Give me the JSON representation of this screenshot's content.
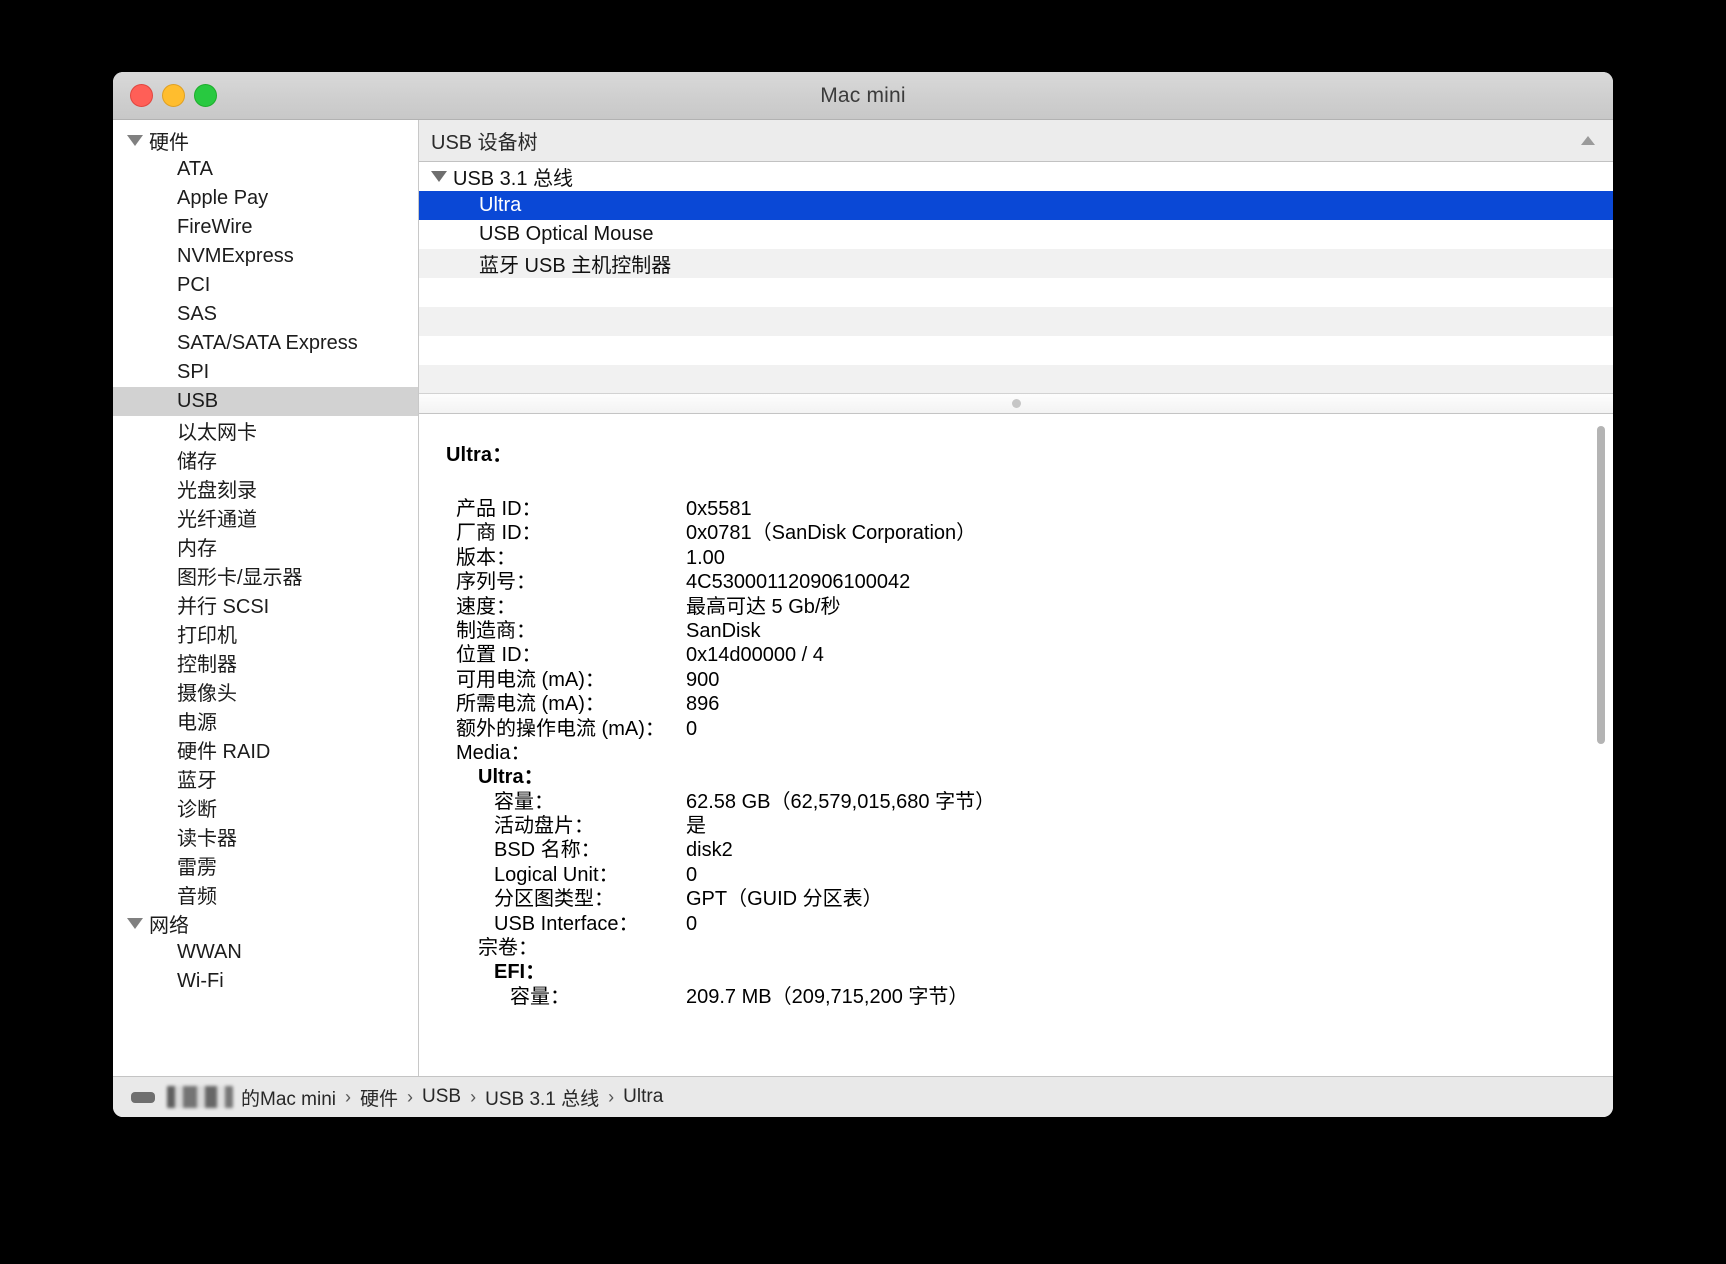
{
  "window": {
    "title": "Mac mini",
    "traffic_lights": [
      "close",
      "minimize",
      "maximize"
    ]
  },
  "sidebar": {
    "groups": [
      {
        "label": "硬件",
        "expanded": true,
        "items": [
          {
            "label": "ATA",
            "selected": false
          },
          {
            "label": "Apple Pay",
            "selected": false
          },
          {
            "label": "FireWire",
            "selected": false
          },
          {
            "label": "NVMExpress",
            "selected": false
          },
          {
            "label": "PCI",
            "selected": false
          },
          {
            "label": "SAS",
            "selected": false
          },
          {
            "label": "SATA/SATA Express",
            "selected": false
          },
          {
            "label": "SPI",
            "selected": false
          },
          {
            "label": "USB",
            "selected": true
          },
          {
            "label": "以太网卡",
            "selected": false
          },
          {
            "label": "储存",
            "selected": false
          },
          {
            "label": "光盘刻录",
            "selected": false
          },
          {
            "label": "光纤通道",
            "selected": false
          },
          {
            "label": "内存",
            "selected": false
          },
          {
            "label": "图形卡/显示器",
            "selected": false
          },
          {
            "label": "并行 SCSI",
            "selected": false
          },
          {
            "label": "打印机",
            "selected": false
          },
          {
            "label": "控制器",
            "selected": false
          },
          {
            "label": "摄像头",
            "selected": false
          },
          {
            "label": "电源",
            "selected": false
          },
          {
            "label": "硬件 RAID",
            "selected": false
          },
          {
            "label": "蓝牙",
            "selected": false
          },
          {
            "label": "诊断",
            "selected": false
          },
          {
            "label": "读卡器",
            "selected": false
          },
          {
            "label": "雷雳",
            "selected": false
          },
          {
            "label": "音频",
            "selected": false
          }
        ]
      },
      {
        "label": "网络",
        "expanded": true,
        "items": [
          {
            "label": "WWAN",
            "selected": false
          },
          {
            "label": "Wi-Fi",
            "selected": false
          }
        ]
      }
    ]
  },
  "section": {
    "title": "USB 设备树",
    "collapse_icon": "chevron-up-icon"
  },
  "device_tree": {
    "rows": [
      {
        "label": "USB 3.1 总线",
        "level": 0,
        "expanded": true,
        "selected": false,
        "stripe": false
      },
      {
        "label": "Ultra",
        "level": 1,
        "expanded": false,
        "selected": true,
        "stripe": false
      },
      {
        "label": "USB Optical Mouse",
        "level": 1,
        "expanded": false,
        "selected": false,
        "stripe": false
      },
      {
        "label": "蓝牙 USB 主机控制器",
        "level": 1,
        "expanded": false,
        "selected": false,
        "stripe": true
      },
      {
        "label": "",
        "level": 1,
        "expanded": false,
        "selected": false,
        "stripe": false
      },
      {
        "label": "",
        "level": 1,
        "expanded": false,
        "selected": false,
        "stripe": true
      },
      {
        "label": "",
        "level": 1,
        "expanded": false,
        "selected": false,
        "stripe": false
      },
      {
        "label": "",
        "level": 1,
        "expanded": false,
        "selected": false,
        "stripe": true
      }
    ],
    "selection_color": "#0a48d6"
  },
  "detail": {
    "heading": "Ultra：",
    "rows": [
      {
        "key": "产品 ID：",
        "value": "0x5581",
        "level": 1,
        "bold": false
      },
      {
        "key": "厂商 ID：",
        "value": "0x0781（SanDisk Corporation）",
        "level": 1,
        "bold": false
      },
      {
        "key": "版本：",
        "value": "1.00",
        "level": 1,
        "bold": false
      },
      {
        "key": "序列号：",
        "value": "4C530001120906100042",
        "level": 1,
        "bold": false
      },
      {
        "key": "速度：",
        "value": "最高可达 5 Gb/秒",
        "level": 1,
        "bold": false
      },
      {
        "key": "制造商：",
        "value": "SanDisk",
        "level": 1,
        "bold": false
      },
      {
        "key": "位置 ID：",
        "value": "0x14d00000 / 4",
        "level": 1,
        "bold": false
      },
      {
        "key": "可用电流 (mA)：",
        "value": "900",
        "level": 1,
        "bold": false
      },
      {
        "key": "所需电流 (mA)：",
        "value": "896",
        "level": 1,
        "bold": false
      },
      {
        "key": "额外的操作电流 (mA)：",
        "value": "0",
        "level": 1,
        "bold": false
      }
    ],
    "media_label": "Media：",
    "media_device": "Ultra：",
    "media_rows": [
      {
        "key": "容量：",
        "value": "62.58 GB（62,579,015,680 字节）"
      },
      {
        "key": "活动盘片：",
        "value": "是"
      },
      {
        "key": "BSD 名称：",
        "value": "disk2"
      },
      {
        "key": "Logical Unit：",
        "value": "0"
      },
      {
        "key": "分区图类型：",
        "value": "GPT（GUID 分区表）"
      },
      {
        "key": "USB Interface：",
        "value": "0"
      }
    ],
    "volumes_label": "宗卷：",
    "volume_name": "EFI：",
    "volume_rows": [
      {
        "key": "容量：",
        "value": "209.7 MB（209,715,200 字节）"
      }
    ]
  },
  "footer": {
    "icon": "mac-mini-icon",
    "redacted": "redacted-name",
    "suffix": "的Mac mini",
    "separator": "›",
    "crumbs": [
      "硬件",
      "USB",
      "USB 3.1 总线",
      "Ultra"
    ]
  }
}
